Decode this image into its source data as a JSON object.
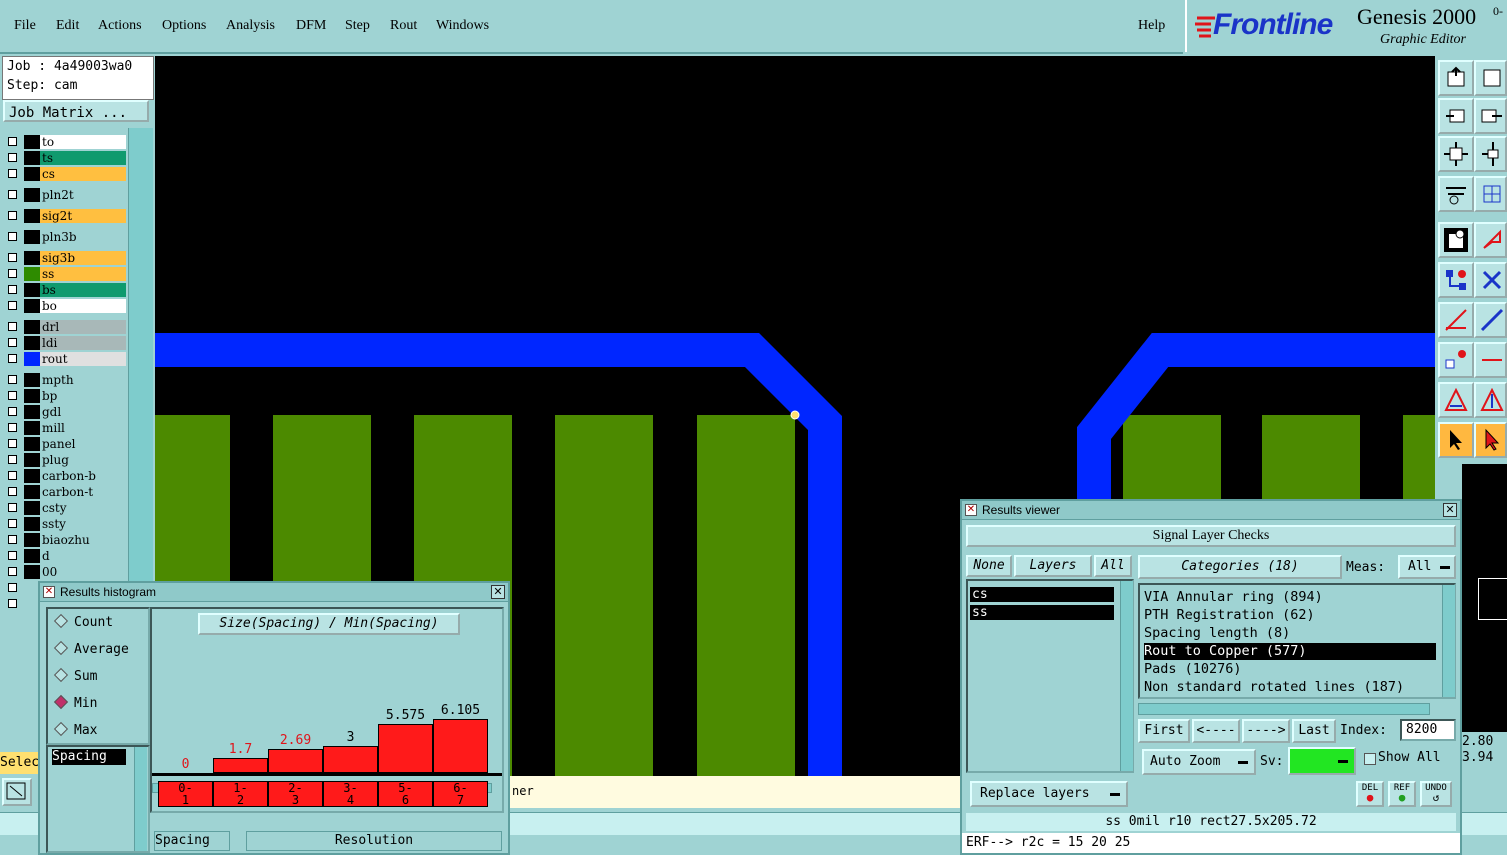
{
  "menu": {
    "items": [
      "File",
      "Edit",
      "Actions",
      "Options",
      "Analysis",
      "DFM",
      "Step",
      "Rout",
      "Windows"
    ],
    "help": "Help"
  },
  "brand": {
    "logo": "Frontline",
    "product": "Genesis 2000",
    "edition": "0-",
    "subtitle": "Graphic Editor"
  },
  "job": {
    "job_line": "Job : 4a49003wa0",
    "step_line": "Step: cam",
    "matrix_button": "Job Matrix ..."
  },
  "layers": [
    {
      "name": "to",
      "color": "#ffffff",
      "swatch": "#000000"
    },
    {
      "name": "ts",
      "color": "#0f9a6e",
      "swatch": "#000000"
    },
    {
      "name": "cs",
      "color": "#ffbf40",
      "swatch": "#000000"
    },
    {
      "name": "pln2t",
      "color": "#9fd3d3",
      "swatch": "#000000"
    },
    {
      "name": "sig2t",
      "color": "#ffbf40",
      "swatch": "#000000"
    },
    {
      "name": "pln3b",
      "color": "#9fd3d3",
      "swatch": "#000000"
    },
    {
      "name": "sig3b",
      "color": "#ffbf40",
      "swatch": "#000000"
    },
    {
      "name": "ss",
      "color": "#ffbf40",
      "swatch": "#2e8b00"
    },
    {
      "name": "bs",
      "color": "#0f9a6e",
      "swatch": "#000000"
    },
    {
      "name": "bo",
      "color": "#ffffff",
      "swatch": "#000000"
    },
    {
      "name": "drl",
      "color": "#a8b8b8",
      "swatch": "#000000"
    },
    {
      "name": "ldi",
      "color": "#a8b8b8",
      "swatch": "#000000"
    },
    {
      "name": "rout",
      "color": "#e0e0e0",
      "swatch": "#0026ff"
    },
    {
      "name": "mpth",
      "color": "#9fd3d3",
      "swatch": "#000000"
    },
    {
      "name": "bp",
      "color": "#9fd3d3",
      "swatch": "#000000"
    },
    {
      "name": "gdl",
      "color": "#9fd3d3",
      "swatch": "#000000"
    },
    {
      "name": "mill",
      "color": "#9fd3d3",
      "swatch": "#000000"
    },
    {
      "name": "panel",
      "color": "#9fd3d3",
      "swatch": "#000000"
    },
    {
      "name": "plug",
      "color": "#9fd3d3",
      "swatch": "#000000"
    },
    {
      "name": "carbon-b",
      "color": "#9fd3d3",
      "swatch": "#000000"
    },
    {
      "name": "carbon-t",
      "color": "#9fd3d3",
      "swatch": "#000000"
    },
    {
      "name": "csty",
      "color": "#9fd3d3",
      "swatch": "#000000"
    },
    {
      "name": "ssty",
      "color": "#9fd3d3",
      "swatch": "#000000"
    },
    {
      "name": "biaozhu",
      "color": "#9fd3d3",
      "swatch": "#000000"
    },
    {
      "name": "d",
      "color": "#9fd3d3",
      "swatch": "#000000"
    },
    {
      "name": "00",
      "color": "#9fd3d3",
      "swatch": "#000000"
    }
  ],
  "status": {
    "select_label": "Selec",
    "bottom_text": "ner",
    "right_values": [
      "2.80",
      "3.94"
    ]
  },
  "histogram": {
    "title": "Results histogram",
    "modes": [
      "Count",
      "Average",
      "Sum",
      "Min",
      "Max"
    ],
    "selected_mode": "Min",
    "list_selected": "Spacing",
    "chart_title": "Size(Spacing) / Min(Spacing)",
    "bottom_field": "Spacing",
    "resolution_label": "Resolution"
  },
  "chart_data": {
    "type": "bar",
    "title": "Size(Spacing) / Min(Spacing)",
    "categories": [
      "0-1",
      "1-2",
      "2-3",
      "3-4",
      "5-6",
      "6-7"
    ],
    "values": [
      0,
      1.7,
      2.69,
      3,
      5.575,
      6.105
    ],
    "value_labels": [
      "0",
      "1.7",
      "2.69",
      "3",
      "5.575",
      "6.105"
    ],
    "ylim": [
      0,
      6.105
    ]
  },
  "results": {
    "title": "Results viewer",
    "section_title": "Signal Layer Checks",
    "none_button": "None",
    "layers_button": "Layers",
    "all_button": "All",
    "layers": [
      "cs",
      "ss"
    ],
    "categories_label": "Categories (18)",
    "meas_label": "Meas:",
    "meas_value": "All",
    "categories": [
      "VIA Annular ring (894)",
      "PTH Registration (62)",
      "Spacing length (8)",
      "Rout to Copper (577)",
      "Pads (10276)",
      "Non standard rotated lines (187)"
    ],
    "selected_category": "Rout to Copper (577)",
    "first_button": "First",
    "prev_button": "<----",
    "next_button": "---->",
    "last_button": "Last",
    "index_label": "Index:",
    "index_value": "8200",
    "auto_zoom": "Auto Zoom",
    "sv_label": "Sv:",
    "show_all": "Show All",
    "replace_layers": "Replace layers",
    "del_label": "DEL",
    "ref_label": "REF",
    "undo_label": "UNDO",
    "info_line": "ss  0mil  r10  rect27.5x205.72",
    "erf_line": "ERF--> r2c = 15 20 25"
  },
  "colors": {
    "background": "#9fd3d3",
    "pad": "#4c8a00",
    "trace": "#0026ff",
    "bar": "#ff1a1a",
    "brand_red": "#e0141a",
    "brand_blue": "#1a34c8"
  }
}
